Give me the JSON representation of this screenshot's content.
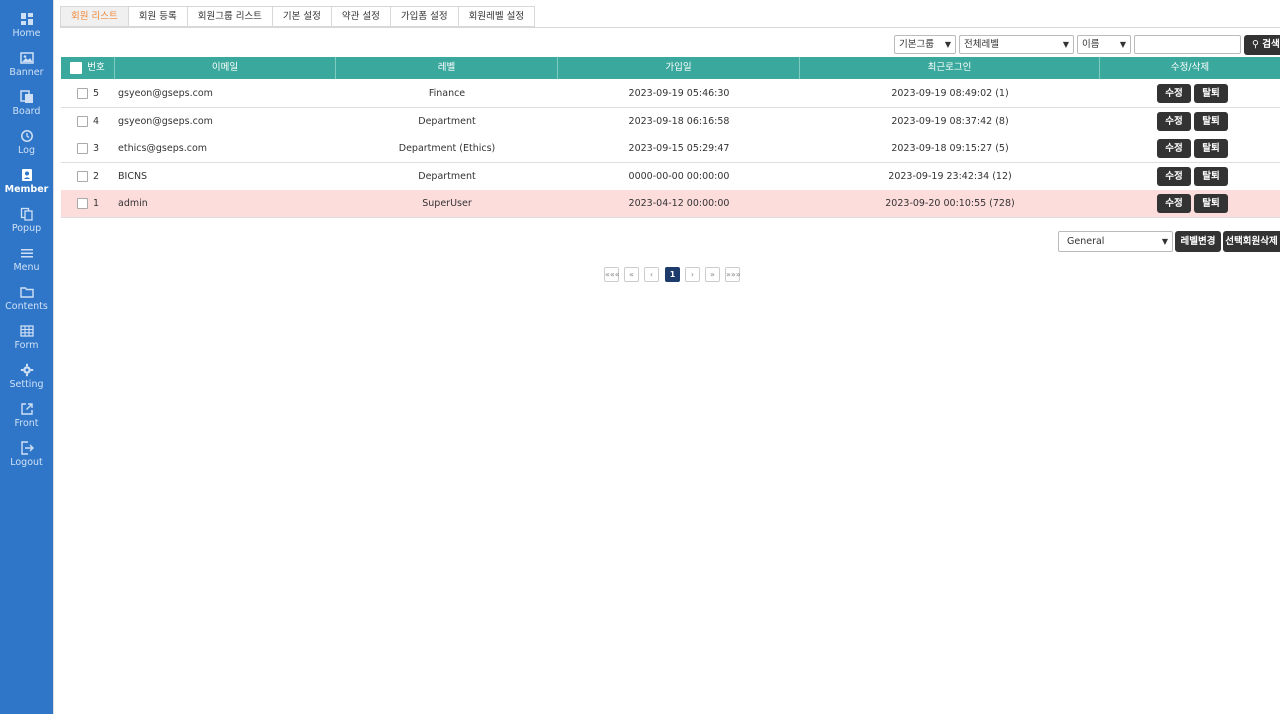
{
  "sidebar": {
    "items": [
      {
        "label": "Home",
        "icon": "dashboard-icon"
      },
      {
        "label": "Banner",
        "icon": "image-icon"
      },
      {
        "label": "Board",
        "icon": "board-icon"
      },
      {
        "label": "Log",
        "icon": "history-icon"
      },
      {
        "label": "Member",
        "icon": "member-icon",
        "active": true
      },
      {
        "label": "Popup",
        "icon": "copy-icon"
      },
      {
        "label": "Menu",
        "icon": "menu-icon"
      },
      {
        "label": "Contents",
        "icon": "folder-icon"
      },
      {
        "label": "Form",
        "icon": "table-icon"
      },
      {
        "label": "Setting",
        "icon": "gear-icon"
      },
      {
        "label": "Front",
        "icon": "external-link-icon"
      },
      {
        "label": "Logout",
        "icon": "logout-icon"
      }
    ]
  },
  "tabs": [
    "회원 리스트",
    "회원 등록",
    "회원그룹 리스트",
    "기본 설정",
    "약관 설정",
    "가입폼 설정",
    "회원레벨 설정"
  ],
  "filters": {
    "group": "기본그룹",
    "level": "전체레벨",
    "field": "이름",
    "search_value": "",
    "search_label": "검색"
  },
  "table": {
    "headers": [
      "번호",
      "이메일",
      "레벨",
      "가입일",
      "최근로그인",
      "수정/삭제"
    ],
    "rows": [
      {
        "no": "5",
        "email": "gsyeon@gseps.com",
        "level": "Finance",
        "joined": "2023-09-19 05:46:30",
        "last_login": "2023-09-19 08:49:02 (1)",
        "highlight": false
      },
      {
        "no": "4",
        "email": "gsyeon@gseps.com",
        "level": "Department",
        "joined": "2023-09-18 06:16:58",
        "last_login": "2023-09-19 08:37:42 (8)",
        "highlight": false
      },
      {
        "no": "3",
        "email": "ethics@gseps.com",
        "level": "Department (Ethics)",
        "joined": "2023-09-15 05:29:47",
        "last_login": "2023-09-18 09:15:27 (5)",
        "highlight": false
      },
      {
        "no": "2",
        "email": "BICNS",
        "level": "Department",
        "joined": "0000-00-00 00:00:00",
        "last_login": "2023-09-19 23:42:34 (12)",
        "highlight": false
      },
      {
        "no": "1",
        "email": "admin",
        "level": "SuperUser",
        "joined": "2023-04-12 00:00:00",
        "last_login": "2023-09-20 00:10:55 (728)",
        "highlight": true
      }
    ],
    "edit_label": "수정",
    "withdraw_label": "탈퇴"
  },
  "bottom": {
    "level_option": "General",
    "change_level_label": "레벨변경",
    "delete_selected_label": "선택회원삭제"
  },
  "pagination": {
    "first": "«««",
    "prev_block": "«",
    "prev": "‹",
    "current": "1",
    "next": "›",
    "next_block": "»",
    "last": "»»»"
  },
  "colors": {
    "sidebar": "#2f76c8",
    "table_header": "#3aa89c",
    "highlight_row": "#fddcdc",
    "active_tab_text": "#f08a3c",
    "current_page": "#1d3b6b"
  }
}
